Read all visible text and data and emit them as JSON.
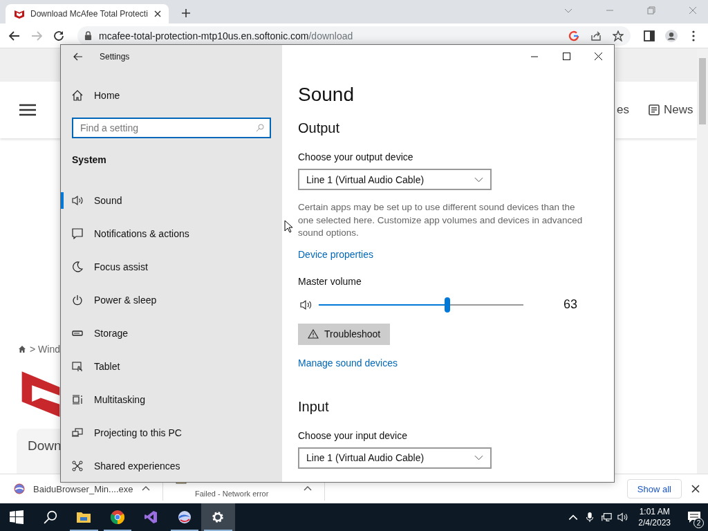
{
  "browser": {
    "tab": {
      "title": "Download McAfee Total Protecti"
    },
    "nav_buttons": [
      {
        "kind": "back",
        "disabled": false
      },
      {
        "kind": "forward",
        "disabled": true
      },
      {
        "kind": "reload",
        "disabled": false
      }
    ],
    "address": {
      "host": "mcafee-total-protection-mtp10us.en.softonic.com",
      "path": "/download"
    }
  },
  "web_page": {
    "nav_items": [
      {
        "label": "es",
        "kind": "plain"
      },
      {
        "label": "News",
        "kind": "news"
      }
    ],
    "breadcrumb": "> Wind",
    "card_title": "Down"
  },
  "settings": {
    "title": "Settings",
    "home": "Home",
    "search": {
      "placeholder": "Find a setting"
    },
    "section": "System",
    "nav": [
      {
        "label": "Sound",
        "kind": "sound",
        "selected": true
      },
      {
        "label": "Notifications & actions",
        "kind": "notifications",
        "selected": false
      },
      {
        "label": "Focus assist",
        "kind": "focus",
        "selected": false
      },
      {
        "label": "Power & sleep",
        "kind": "power",
        "selected": false
      },
      {
        "label": "Storage",
        "kind": "storage",
        "selected": false
      },
      {
        "label": "Tablet",
        "kind": "tablet",
        "selected": false
      },
      {
        "label": "Multitasking",
        "kind": "multitasking",
        "selected": false
      },
      {
        "label": "Projecting to this PC",
        "kind": "projecting",
        "selected": false
      },
      {
        "label": "Shared experiences",
        "kind": "shared",
        "selected": false
      }
    ],
    "page": {
      "title": "Sound",
      "output": {
        "heading": "Output",
        "label": "Choose your output device",
        "device": "Line 1 (Virtual Audio Cable)",
        "note": "Certain apps may be set up to use different sound devices than the one selected here. Customize app volumes and devices in advanced sound options.",
        "link": "Device properties",
        "volume_label": "Master volume",
        "volume": {
          "level": 0.63,
          "reading": "63"
        },
        "troubleshoot": "Troubleshoot",
        "manage_link": "Manage sound devices"
      },
      "input": {
        "heading": "Input",
        "label": "Choose your input device",
        "device": "Line 1 (Virtual Audio Cable)"
      }
    }
  },
  "downloads": {
    "items": [
      {
        "name": "BaiduBrowser_Min....exe"
      },
      {
        "status": "Failed - Network error"
      }
    ],
    "show_all": "Show all"
  },
  "taskbar": {
    "apps": [
      {
        "kind": "explorer",
        "running": true,
        "selected": false
      },
      {
        "kind": "chrome",
        "running": true,
        "selected": false
      },
      {
        "kind": "studio",
        "running": false,
        "selected": false
      },
      {
        "kind": "baidu",
        "running": true,
        "selected": false
      },
      {
        "kind": "settings",
        "running": true,
        "selected": true
      }
    ],
    "time": "1:01 AM",
    "date": "2/4/2023",
    "notifications": "2"
  }
}
